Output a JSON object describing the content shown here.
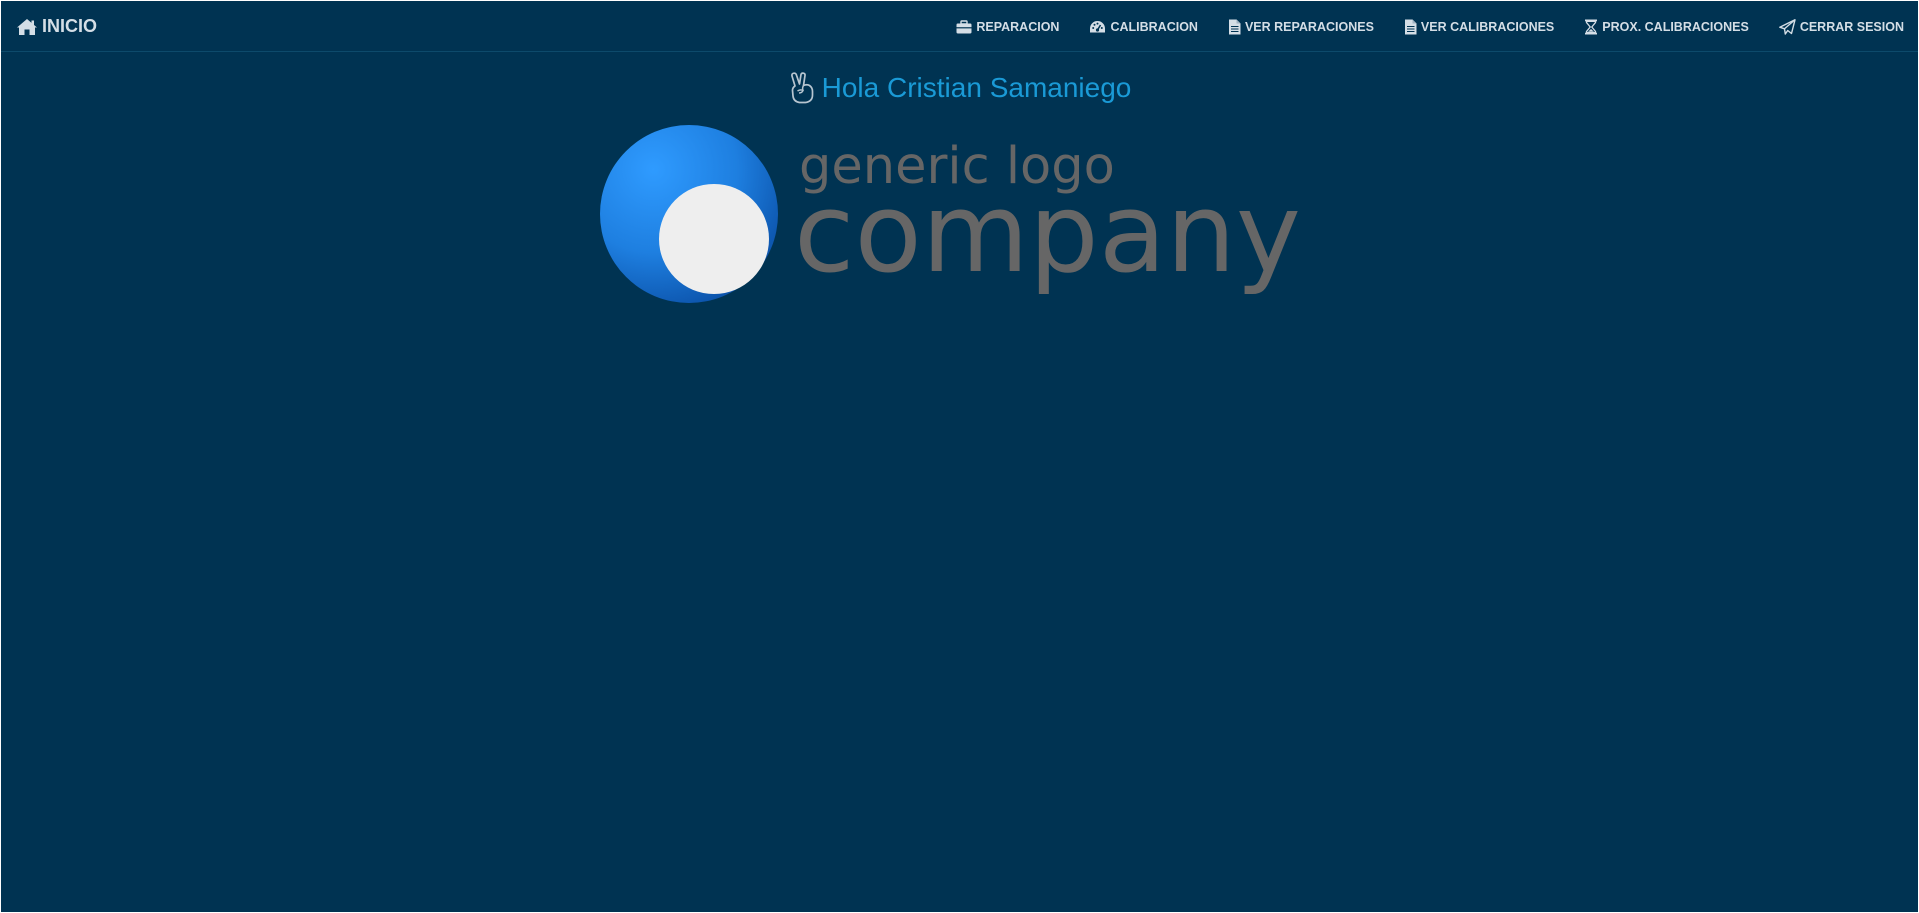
{
  "navbar": {
    "brand": {
      "label": "INICIO",
      "icon": "home-icon"
    },
    "items": [
      {
        "label": "REPARACION",
        "icon": "briefcase-icon"
      },
      {
        "label": "CALIBRACION",
        "icon": "dashboard-gauge-icon"
      },
      {
        "label": "VER REPARACIONES",
        "icon": "document-icon"
      },
      {
        "label": "VER CALIBRACIONES",
        "icon": "document-icon"
      },
      {
        "label": "PROX. CALIBRACIONES",
        "icon": "hourglass-icon"
      },
      {
        "label": "CERRAR SESION",
        "icon": "paper-plane-icon"
      }
    ]
  },
  "main": {
    "greeting": "Hola Cristian Samaniego",
    "greeting_icon": "hand-peace-icon",
    "logo": {
      "line1": "generic logo",
      "line2": "company"
    }
  },
  "colors": {
    "background": "#003352",
    "nav_text": "#d4dee6",
    "greeting_text": "#1a9ad6",
    "logo_text": "#666666",
    "logo_blue": "#1e88e5",
    "logo_circle": "#eeeeee"
  }
}
